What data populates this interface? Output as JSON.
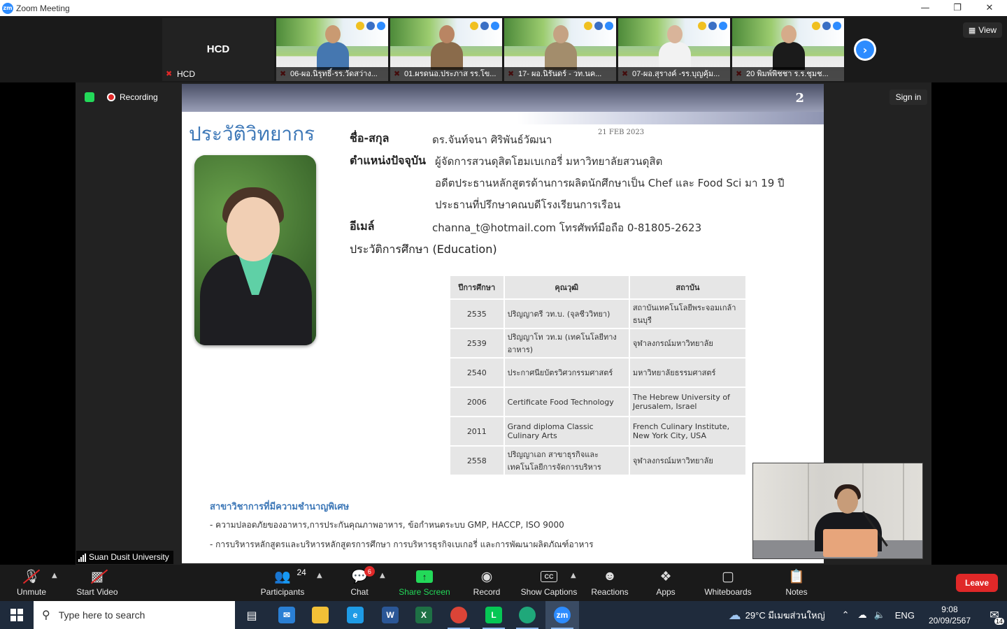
{
  "window": {
    "title": "Zoom Meeting",
    "logo": "zm"
  },
  "strip": {
    "host_tile": {
      "name_big": "HCD",
      "name_label": "HCD"
    },
    "tiles": [
      {
        "label": "06-ผอ.นิรุทธิ์-รร.วัดสว่าง..."
      },
      {
        "label": "01.ผรดนอ.ประภาส รร.โข..."
      },
      {
        "label": "17- ผอ.นิรันดร์ - วท.นค..."
      },
      {
        "label": "07-ผอ.สุรางค์ -รร.บุญคุ้ม..."
      },
      {
        "label": "20 พิมพ์พิชชา ร.ร.ชุมช..."
      }
    ],
    "view_label": "View"
  },
  "stage": {
    "recording_label": "Recording",
    "signin_label": "Sign in",
    "footer_name": "Suan Dusit University"
  },
  "slide": {
    "page_number": "2",
    "title": "ประวัติวิทยากร",
    "date": "21 FEB 2023",
    "fields": {
      "name_label": "ชื่อ-สกุล",
      "name_value": "ดร.จันท์จนา ศิริพันธ์วัฒนา",
      "position_label": "ตำแหน่งปัจจุบัน",
      "position_value_1": "ผู้จัดการสวนดุสิตโฮมเบเกอรี่ มหาวิทยาลัยสวนดุสิต",
      "position_value_2": "อดีตประธานหลักสูตรด้านการผลิตนักศึกษาเป็น Chef และ Food Sci มา 19 ปี",
      "position_value_3": "ประธานที่ปรึกษาคณบดีโรงเรียนการเรือน",
      "email_label": "อีเมล์",
      "email_value": "channa_t@hotmail.com โทรศัพท์มือถือ 0-81805-2623",
      "education_label": "ประวัติการศึกษา (Education)"
    },
    "education_table": {
      "headers": [
        "ปีการศึกษา",
        "คุณวุฒิ",
        "สถาบัน"
      ],
      "rows": [
        {
          "year": "2535",
          "degree": "ปริญญาตรี วท.บ. (จุลชีววิทยา)",
          "institution": "สถาบันเทคโนโลยีพระจอมเกล้าธนบุรี"
        },
        {
          "year": "2539",
          "degree": "ปริญญาโท วท.ม (เทคโนโลยีทางอาหาร)",
          "institution": "จุฬาลงกรณ์มหาวิทยาลัย"
        },
        {
          "year": "2540",
          "degree": "ประกาศนียบัตรวิศวกรรมศาสตร์",
          "institution": "มหาวิทยาลัยธรรมศาสตร์"
        },
        {
          "year": "2006",
          "degree": "Certificate Food Technology",
          "institution": "The Hebrew University of Jerusalem, Israel"
        },
        {
          "year": "2011",
          "degree": "Grand diploma Classic Culinary Arts",
          "institution": "French Culinary Institute, New York City, USA"
        },
        {
          "year": "2558",
          "degree": "ปริญญาเอก สาขาธุรกิจและเทคโนโลยีการจัดการบริหาร",
          "institution": "จุฬาลงกรณ์มหาวิทยาลัย"
        }
      ]
    },
    "expertise_title": "สาขาวิชาการที่มีความชำนาญพิเศษ",
    "expertise_1": "- ความปลอดภัยของอาหาร,การประกันคุณภาพอาหาร, ข้อกำหนดระบบ GMP, HACCP, ISO 9000",
    "expertise_2": "- การบริหารหลักสูตรและบริหารหลักสูตรการศึกษา การบริหารธุรกิจเบเกอรี่ และการพัฒนาผลิตภัณฑ์อาหาร"
  },
  "toolbar": {
    "unmute": "Unmute",
    "start_video": "Start Video",
    "participants": "Participants",
    "participants_count": "24",
    "chat": "Chat",
    "chat_badge": "6",
    "share_screen": "Share Screen",
    "record": "Record",
    "show_captions": "Show Captions",
    "cc": "CC",
    "reactions": "Reactions",
    "apps": "Apps",
    "whiteboards": "Whiteboards",
    "notes": "Notes",
    "leave": "Leave"
  },
  "taskbar": {
    "search_placeholder": "Type here to search",
    "weather": "29°C  มีเมฆส่วนใหญ่",
    "lang": "ENG",
    "time": "9:08",
    "date": "20/09/2567",
    "notifications": "14"
  },
  "colors": {
    "accent": "#2d8cff",
    "leave": "#e02828",
    "share": "#23d959",
    "slide_title": "#3f79b8"
  }
}
